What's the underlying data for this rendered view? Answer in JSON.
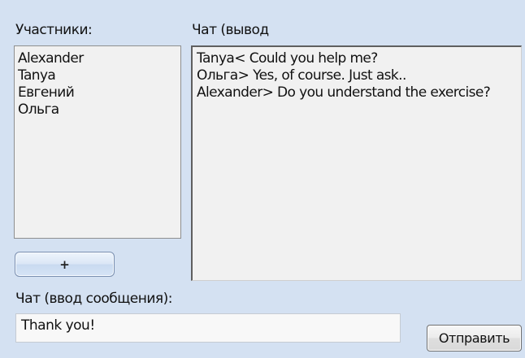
{
  "labels": {
    "participants": "Участники:",
    "chat_output": "Чат (вывод",
    "chat_input": "Чат (ввод сообщения):"
  },
  "participants": [
    "Alexander",
    "Tanya",
    "Евгений",
    "Ольга"
  ],
  "chat_lines": [
    "Tanya< Could you help me?",
    "Ольга> Yes, of course. Just ask..",
    "Alexander> Do you understand the exercise?"
  ],
  "add_button": {
    "label": "+"
  },
  "message_input": {
    "value": "Thank you!"
  },
  "send_button": {
    "label": "Отправить"
  },
  "colors": {
    "window_background": "#d4e1f2",
    "list_background": "#f1f1f1",
    "text": "#111111"
  }
}
